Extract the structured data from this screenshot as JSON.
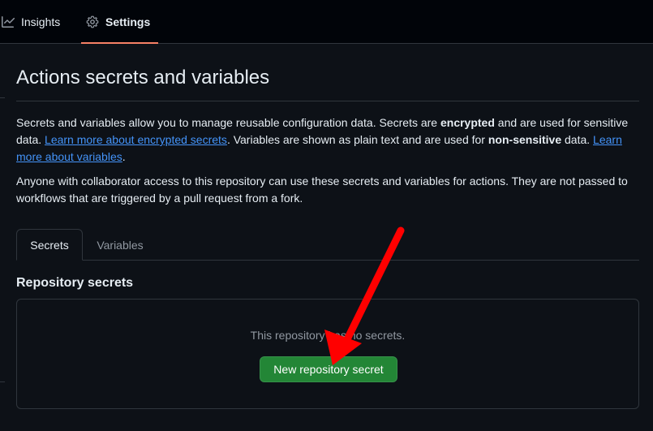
{
  "nav": {
    "insights_label": "Insights",
    "settings_label": "Settings",
    "active_underline_color": "#f78166"
  },
  "page": {
    "title": "Actions secrets and variables",
    "description_1": {
      "part_a": "Secrets and variables allow you to manage reusable configuration data. Secrets are ",
      "bold_a": "encrypted",
      "part_b": " and are used for sensitive data. ",
      "link_a": "Learn more about encrypted secrets",
      "part_c": ". Variables are shown as plain text and are used for ",
      "bold_b": "non-sensitive",
      "part_d": " data. ",
      "link_b": "Learn more about variables",
      "part_e": "."
    },
    "description_2": "Anyone with collaborator access to this repository can use these secrets and variables for actions. They are not passed to workflows that are triggered by a pull request from a fork."
  },
  "tabs": [
    {
      "label": "Secrets",
      "active": true
    },
    {
      "label": "Variables",
      "active": false
    }
  ],
  "repository_secrets": {
    "heading": "Repository secrets",
    "empty_text": "This repository has no secrets.",
    "new_button_label": "New repository secret",
    "button_color": "#238636"
  },
  "annotation": {
    "arrow_color": "#ff0000"
  },
  "colors": {
    "link": "#4493f8",
    "background": "#0d1117",
    "border": "#30363d"
  }
}
